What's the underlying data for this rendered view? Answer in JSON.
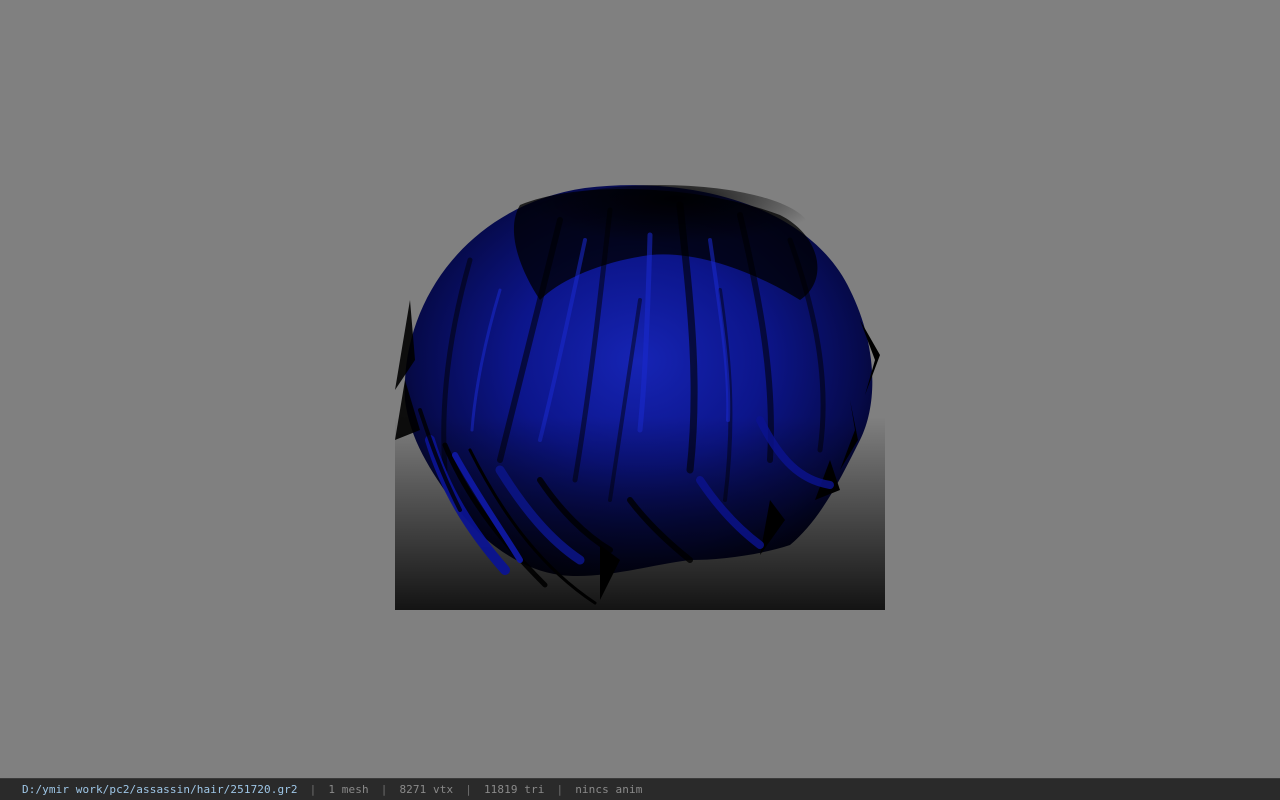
{
  "viewport": {
    "background_color": "#808080",
    "model": {
      "name": "hair-mesh",
      "base_color": "#0a0f6e",
      "highlight_color": "#1a28c8",
      "shadow_color": "#000000"
    }
  },
  "status_bar": {
    "file_path": "D:/ymir work/pc2/assassin/hair/251720.gr2",
    "separator": "|",
    "mesh_count": "1 mesh",
    "vertex_count": "8271 vtx",
    "triangle_count": "11819 tri",
    "anim_info": "nincs anim"
  }
}
